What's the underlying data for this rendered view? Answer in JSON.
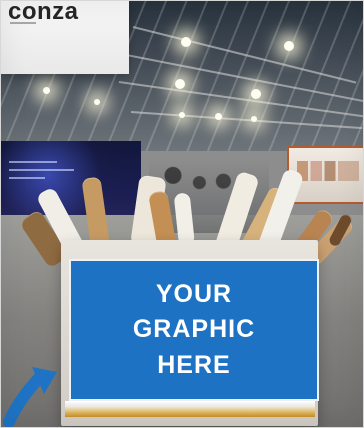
{
  "banner": {
    "text": "conza"
  },
  "graphic_card": {
    "line1": "YOUR",
    "line2": "GRAPHIC",
    "line3": "HERE"
  },
  "colors": {
    "card_blue": "#1e72c3",
    "card_text": "#ffffff",
    "arrow_blue": "#1f73c4"
  },
  "icons": {
    "arrow": "arrow-icon"
  }
}
